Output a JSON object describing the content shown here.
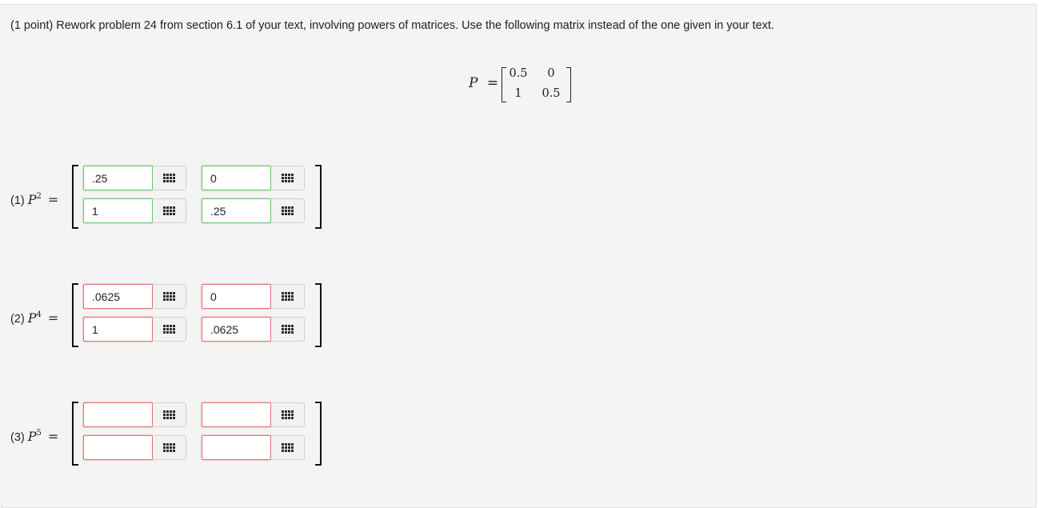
{
  "problem": {
    "text": "(1 point) Rework problem 24 from section 6.1 of your text, involving powers of matrices. Use the following matrix instead of the one given in your text."
  },
  "given_matrix": {
    "symbol": "P",
    "equals": "=",
    "cells": [
      [
        "0.5",
        "0"
      ],
      [
        "1",
        "0.5"
      ]
    ]
  },
  "answers": [
    {
      "label": "(1)",
      "base": "P",
      "exponent": "2",
      "equals": "=",
      "status": "correct",
      "cells": [
        [
          ".25",
          "0"
        ],
        [
          "1",
          ".25"
        ]
      ]
    },
    {
      "label": "(2)",
      "base": "P",
      "exponent": "4",
      "equals": "=",
      "status": "wrong",
      "cells": [
        [
          ".0625",
          "0"
        ],
        [
          "1",
          ".0625"
        ]
      ]
    },
    {
      "label": "(3)",
      "base": "P",
      "exponent": "5",
      "equals": "=",
      "status": "wrong",
      "cells": [
        [
          "",
          ""
        ],
        [
          "",
          ""
        ]
      ]
    }
  ],
  "icons": {
    "matrix_button": "grid-icon"
  },
  "colors": {
    "correct_border": "#6cc36c",
    "wrong_border": "#e07070",
    "panel_bg": "#f4f4f4"
  }
}
